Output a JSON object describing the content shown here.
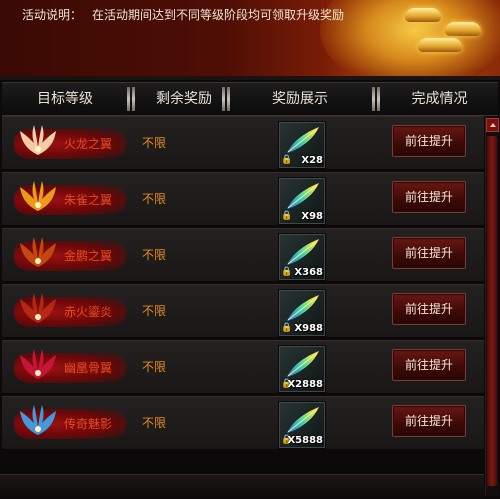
{
  "notice": {
    "label": "活动说明：",
    "text": "在活动期间达到不同等级阶段均可领取升级奖励"
  },
  "header": {
    "col_rank": "目标等级",
    "col_remain": "剩余奖励",
    "col_reward": "奖励展示",
    "col_status": "完成情况"
  },
  "rows": [
    {
      "name": "火龙之翼",
      "remain": "不限",
      "count": "X28",
      "action": "前往提升",
      "wing_color": "#f6d8b0"
    },
    {
      "name": "朱雀之翼",
      "remain": "不限",
      "count": "X98",
      "action": "前往提升",
      "wing_color": "#f0a21a"
    },
    {
      "name": "金鹏之翼",
      "remain": "不限",
      "count": "X368",
      "action": "前往提升",
      "wing_color": "#c64b12"
    },
    {
      "name": "赤火鎏炎",
      "remain": "不限",
      "count": "X988",
      "action": "前往提升",
      "wing_color": "#b72a14"
    },
    {
      "name": "幽凰骨翼",
      "remain": "不限",
      "count": "X2888",
      "action": "前往提升",
      "wing_color": "#c9163a"
    },
    {
      "name": "传奇魅影",
      "remain": "不限",
      "count": "X5888",
      "action": "前往提升",
      "wing_color": "#3fa2e6"
    }
  ],
  "icons": {
    "reward": "feather-icon",
    "lock": "lock-icon",
    "wing": "wing-icon"
  },
  "colors": {
    "rank_name": "#e24b22",
    "remain": "#e88a1c",
    "button_bg": "#5a120e"
  }
}
